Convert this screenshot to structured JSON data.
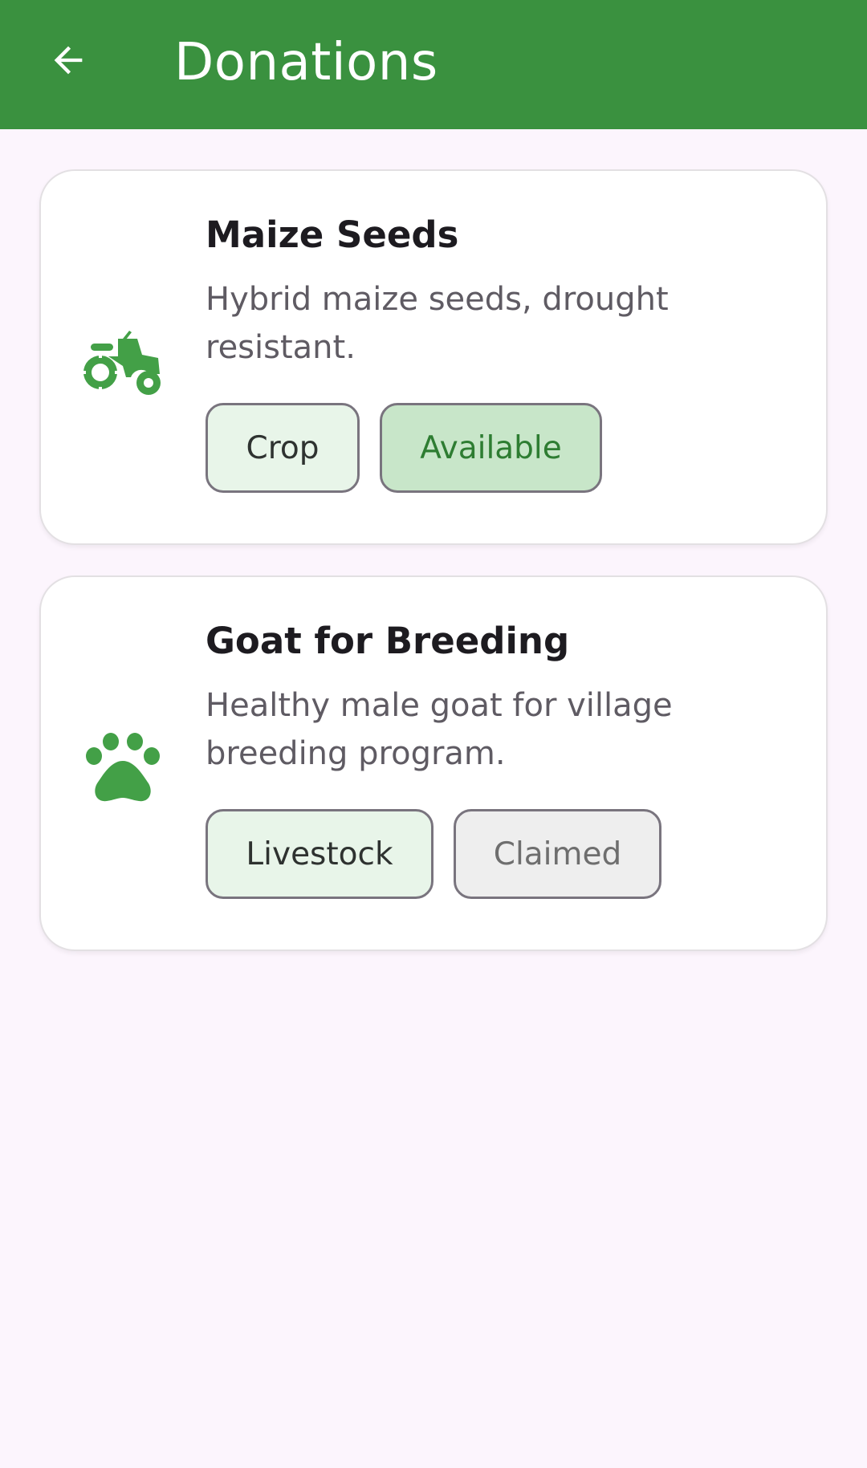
{
  "appbar": {
    "title": "Donations",
    "back_icon": "arrow-back-icon",
    "color": "#3a913f"
  },
  "donations": [
    {
      "icon": "tractor-icon",
      "title": "Maize Seeds",
      "description": "Hybrid maize seeds, drought resistant.",
      "category": "Crop",
      "status": "Available"
    },
    {
      "icon": "paw-icon",
      "title": "Goat for Breeding",
      "description": "Healthy male goat for village breeding program.",
      "category": "Livestock",
      "status": "Claimed"
    }
  ],
  "colors": {
    "accent": "#3a913f",
    "icon_green": "#43a047",
    "available_bg": "#c8e6c9",
    "available_text": "#2e7d32",
    "claimed_bg": "#eeeeee",
    "category_bg": "#e8f5e9"
  }
}
